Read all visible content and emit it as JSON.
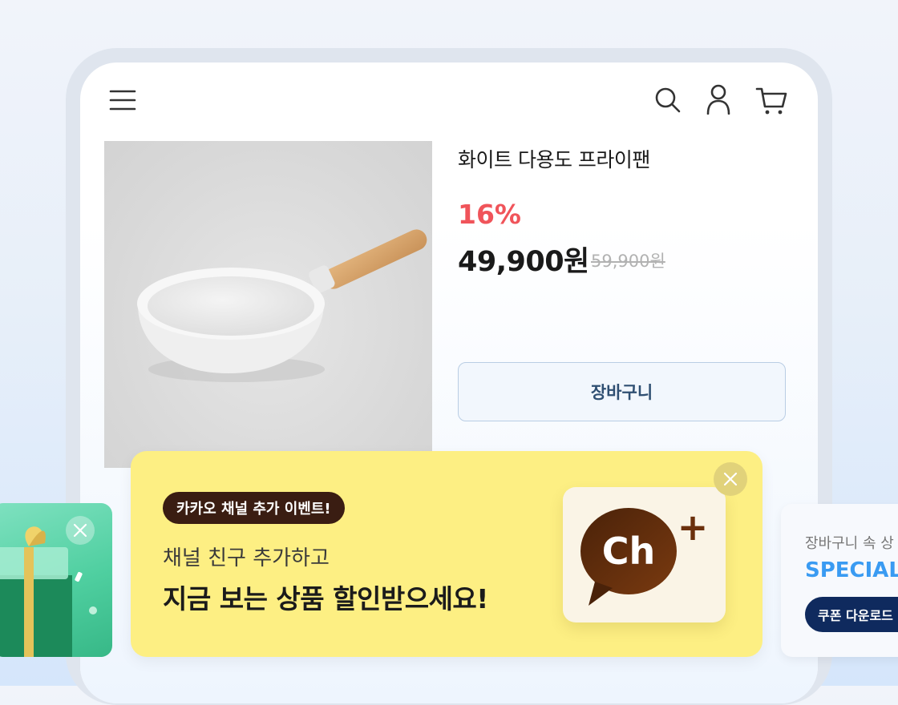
{
  "header": {
    "menu_icon": "hamburger-menu-icon",
    "search_icon": "search-icon",
    "account_icon": "user-icon",
    "cart_icon": "cart-icon"
  },
  "product": {
    "title": "화이트 다용도 프라이팬",
    "discount": "16%",
    "price": "49,900원",
    "original_price": "59,900원",
    "cart_button": "장바구니",
    "image": "white-frying-pan-image",
    "discount_color": "#f0545a"
  },
  "kakao_banner": {
    "pill": "카카오 채널 추가 이벤트!",
    "subtitle": "채널 친구 추가하고",
    "headline": "지금 보는 상품 할인받으세요!",
    "logo_text": "Ch",
    "logo_plus": "+",
    "background": "#fdef83",
    "logo_color": "#5b2a0c"
  },
  "coupon_card": {
    "subtitle": "장바구니 속 상",
    "headline": "SPECIAL",
    "button": "쿠폰 다운로드",
    "accent": "#3a9bf2",
    "button_color": "#0f2a5e"
  },
  "gift_card": {
    "icon": "gift-box-icon"
  }
}
